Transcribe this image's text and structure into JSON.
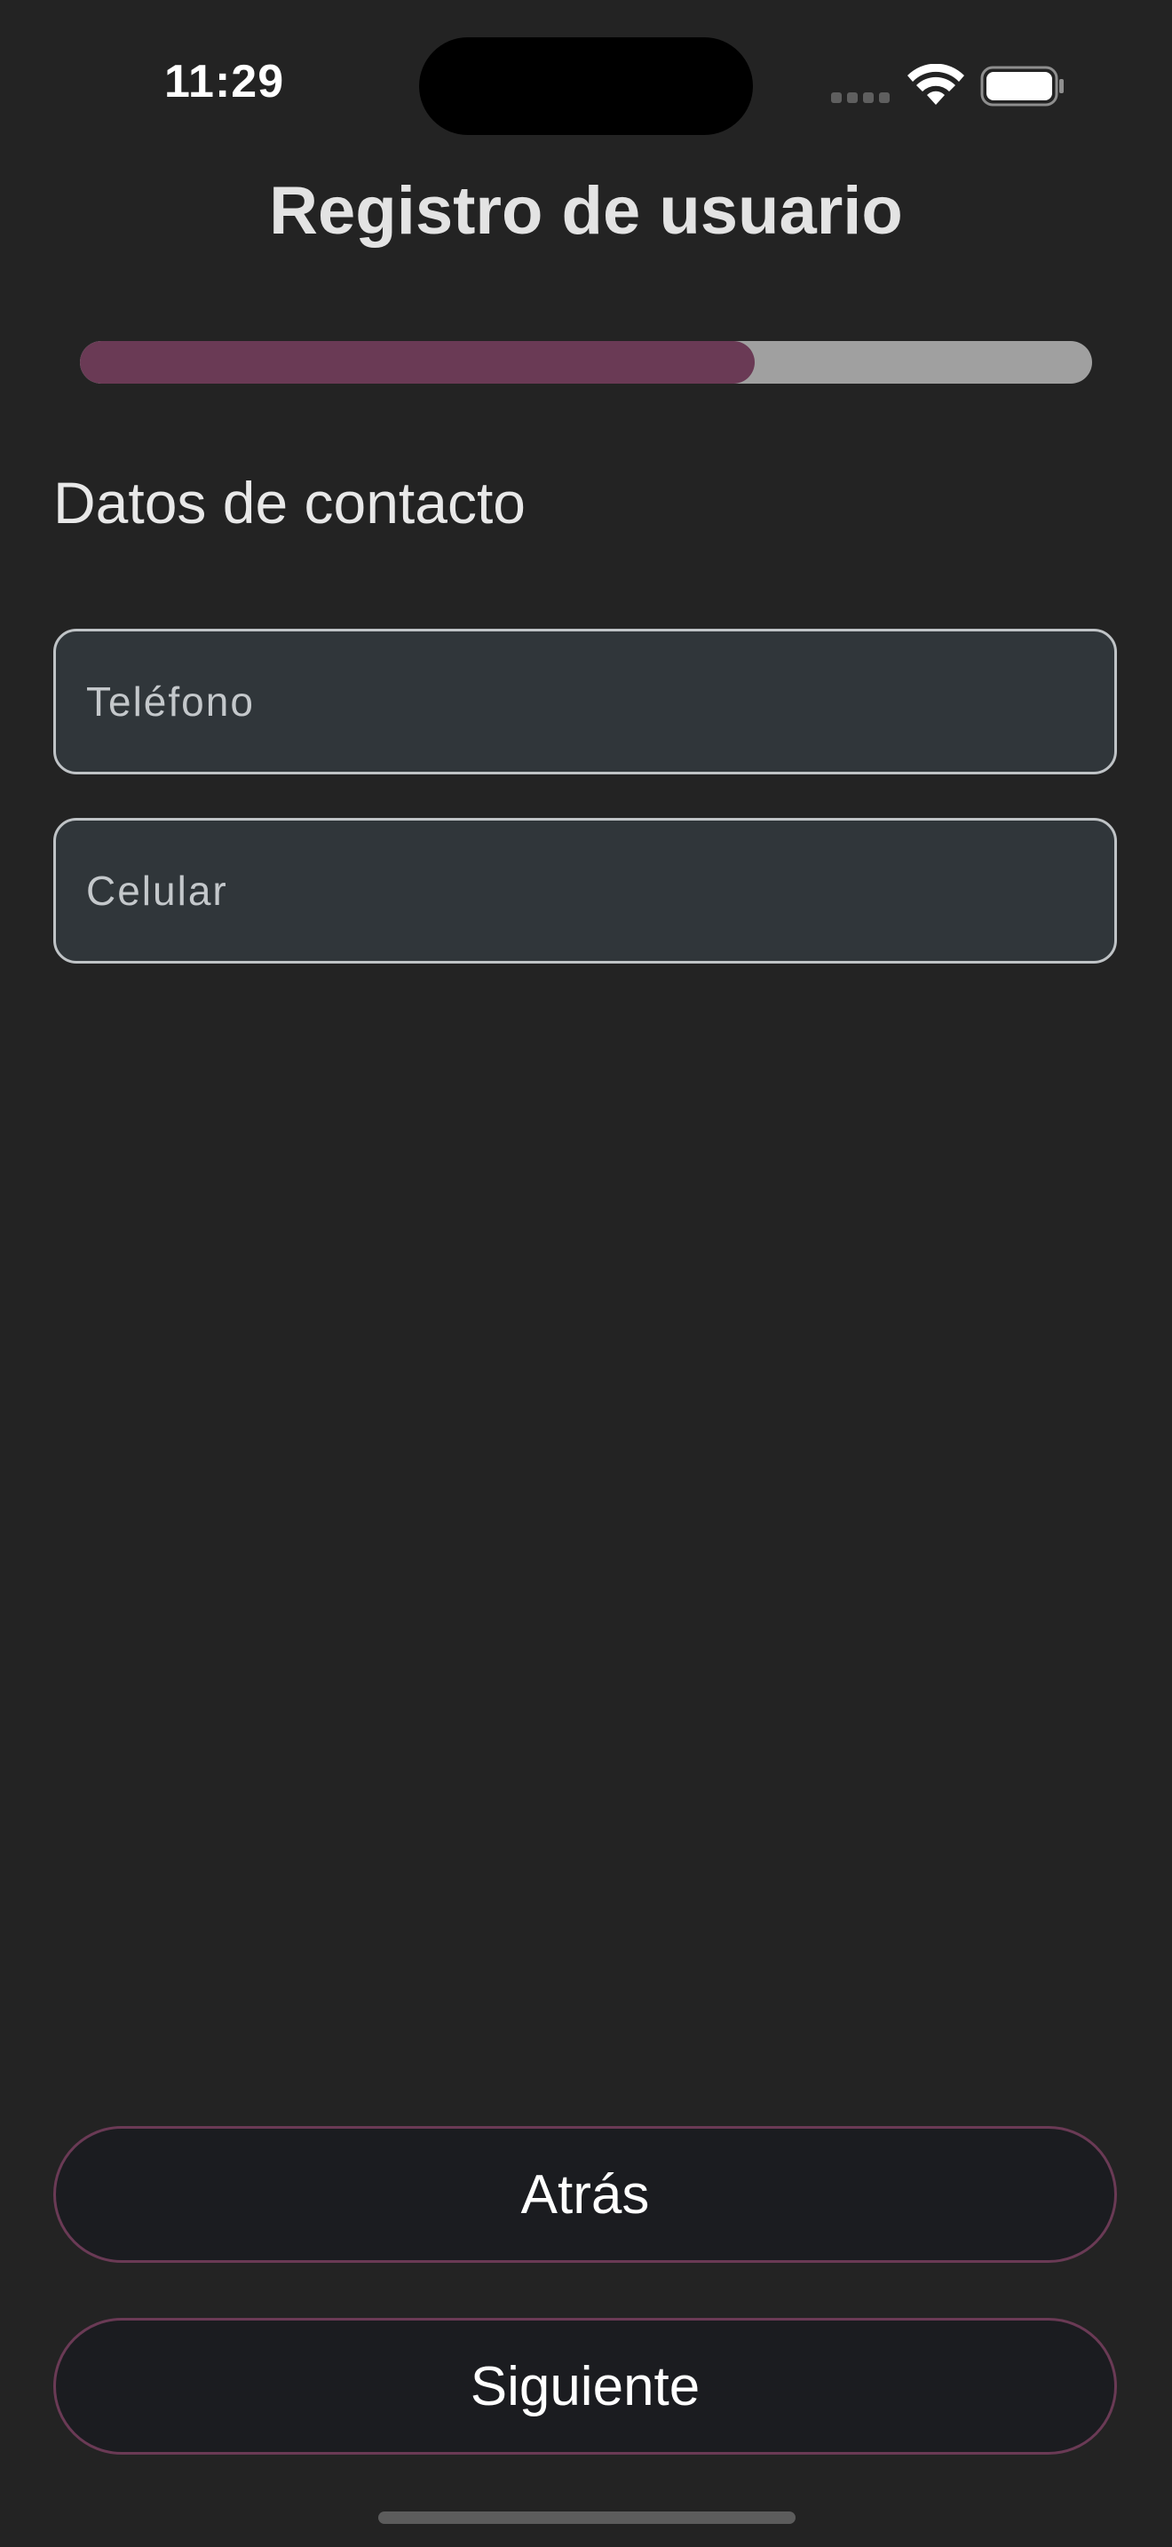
{
  "status_bar": {
    "time": "11:29",
    "icons": [
      "signal-dots-icon",
      "wifi-icon",
      "battery-icon"
    ]
  },
  "header": {
    "title": "Registro de usuario"
  },
  "progress": {
    "value": 0.667,
    "fill_color": "#6a3a55",
    "track_color": "#a0a0a0"
  },
  "section": {
    "title": "Datos de contacto"
  },
  "form": {
    "phone": {
      "value": "",
      "placeholder": "Teléfono"
    },
    "mobile": {
      "value": "",
      "placeholder": "Celular"
    }
  },
  "actions": {
    "back_label": "Atrás",
    "next_label": "Siguiente",
    "accent_color": "#6a3a55"
  },
  "colors": {
    "background": "#232323",
    "field_background": "#30363a",
    "button_background": "#1b1c20"
  }
}
